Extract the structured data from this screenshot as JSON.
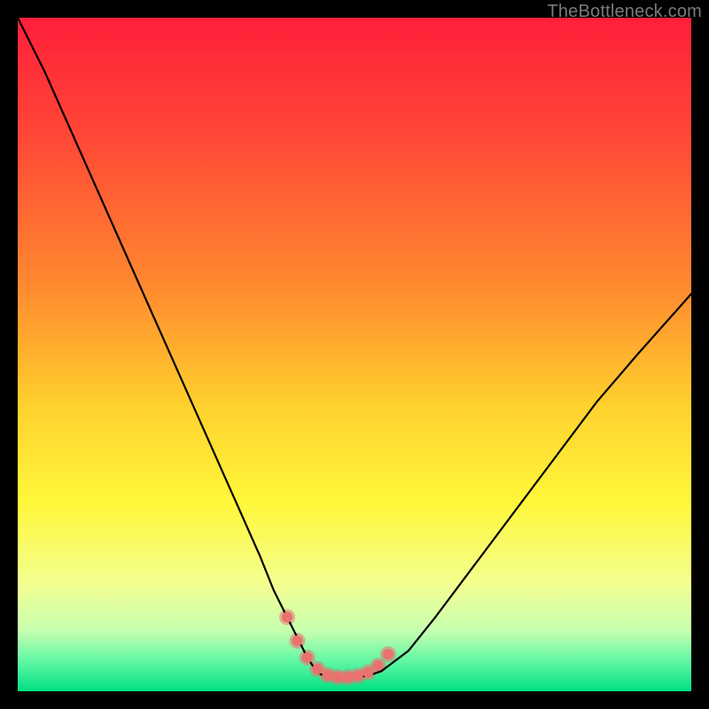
{
  "watermark": "TheBottleneck.com",
  "chart_data": {
    "type": "line",
    "title": "",
    "xlabel": "",
    "ylabel": "",
    "xlim": [
      0,
      100
    ],
    "ylim": [
      0,
      100
    ],
    "gradient_stops": [
      {
        "offset": 0.0,
        "color": "#ff1f3a"
      },
      {
        "offset": 0.18,
        "color": "#ff4836"
      },
      {
        "offset": 0.4,
        "color": "#ff8a2f"
      },
      {
        "offset": 0.58,
        "color": "#ffd22e"
      },
      {
        "offset": 0.72,
        "color": "#fff73a"
      },
      {
        "offset": 0.84,
        "color": "#f4ff90"
      },
      {
        "offset": 0.91,
        "color": "#c7ffb0"
      },
      {
        "offset": 0.955,
        "color": "#61f7a4"
      },
      {
        "offset": 1.0,
        "color": "#00e083"
      }
    ],
    "series": [
      {
        "name": "bottleneck-curve",
        "color": "#000000",
        "width": 2.2,
        "x": [
          0,
          4,
          8,
          12,
          16,
          20,
          24,
          28,
          32,
          36,
          38,
          40,
          42,
          43,
          44,
          45,
          46,
          48,
          50,
          52,
          54,
          58,
          62,
          68,
          74,
          80,
          86,
          92,
          100
        ],
        "y": [
          100,
          92,
          83,
          74,
          65,
          56,
          47,
          38,
          29,
          20,
          15,
          11,
          7,
          5,
          3.5,
          2.5,
          2.2,
          2.1,
          2.1,
          2.3,
          3.0,
          6,
          11,
          19,
          27,
          35,
          43,
          50,
          59
        ]
      }
    ],
    "marker_series": {
      "name": "highlight-dots",
      "color": "#e9726f",
      "radius_outer": 9,
      "radius_inner": 6,
      "x": [
        40,
        41.5,
        43,
        44.5,
        46,
        47.5,
        49,
        50.5,
        52,
        53.5,
        55
      ],
      "y": [
        11,
        7.5,
        5,
        3.3,
        2.4,
        2.1,
        2.1,
        2.3,
        2.8,
        3.8,
        5.5
      ]
    }
  }
}
